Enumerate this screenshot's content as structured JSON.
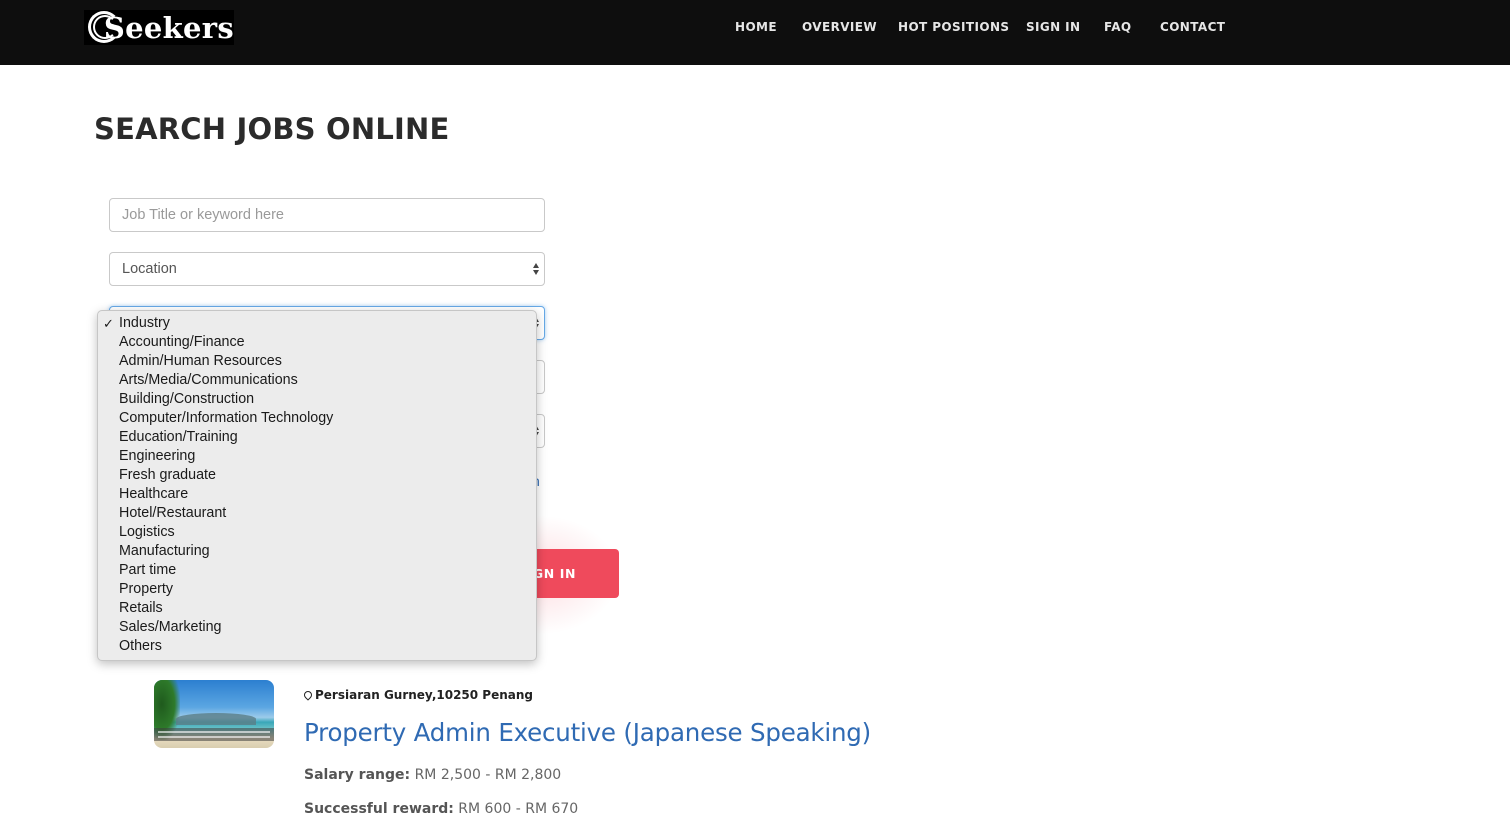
{
  "brand": {
    "name": "Seekers"
  },
  "nav": {
    "items": [
      {
        "label": "HOME"
      },
      {
        "label": "OVERVIEW"
      },
      {
        "label": "HOT POSITIONS"
      },
      {
        "label": "SIGN IN"
      },
      {
        "label": "FAQ"
      },
      {
        "label": "CONTACT"
      }
    ]
  },
  "search": {
    "title": "SEARCH JOBS ONLINE",
    "keyword_placeholder": "Job Title or keyword here",
    "location_value": "Location",
    "industry_value": "Industry",
    "link_partial": "h",
    "signin_label": "GN IN",
    "industry_options": [
      {
        "label": "Industry",
        "selected": true
      },
      {
        "label": "Accounting/Finance"
      },
      {
        "label": "Admin/Human Resources"
      },
      {
        "label": "Arts/Media/Communications"
      },
      {
        "label": "Building/Construction"
      },
      {
        "label": "Computer/Information Technology"
      },
      {
        "label": "Education/Training"
      },
      {
        "label": "Engineering"
      },
      {
        "label": "Fresh graduate"
      },
      {
        "label": "Healthcare"
      },
      {
        "label": "Hotel/Restaurant"
      },
      {
        "label": "Logistics"
      },
      {
        "label": "Manufacturing"
      },
      {
        "label": "Part time"
      },
      {
        "label": "Property"
      },
      {
        "label": "Retails"
      },
      {
        "label": "Sales/Marketing"
      },
      {
        "label": "Others"
      }
    ],
    "check_glyph": "✓"
  },
  "job": {
    "location": "Persiaran Gurney,10250 Penang",
    "title": "Property Admin Executive (Japanese Speaking)",
    "salary_label": "Salary range:",
    "salary_value": "RM 2,500 - RM 2,800",
    "reward_label": "Successful reward:",
    "reward_value": "RM 600 - RM 670"
  },
  "colors": {
    "navbar_bg": "#0e0e0e",
    "accent_red": "#ef4a5c",
    "link_blue": "#2f6ab3"
  }
}
